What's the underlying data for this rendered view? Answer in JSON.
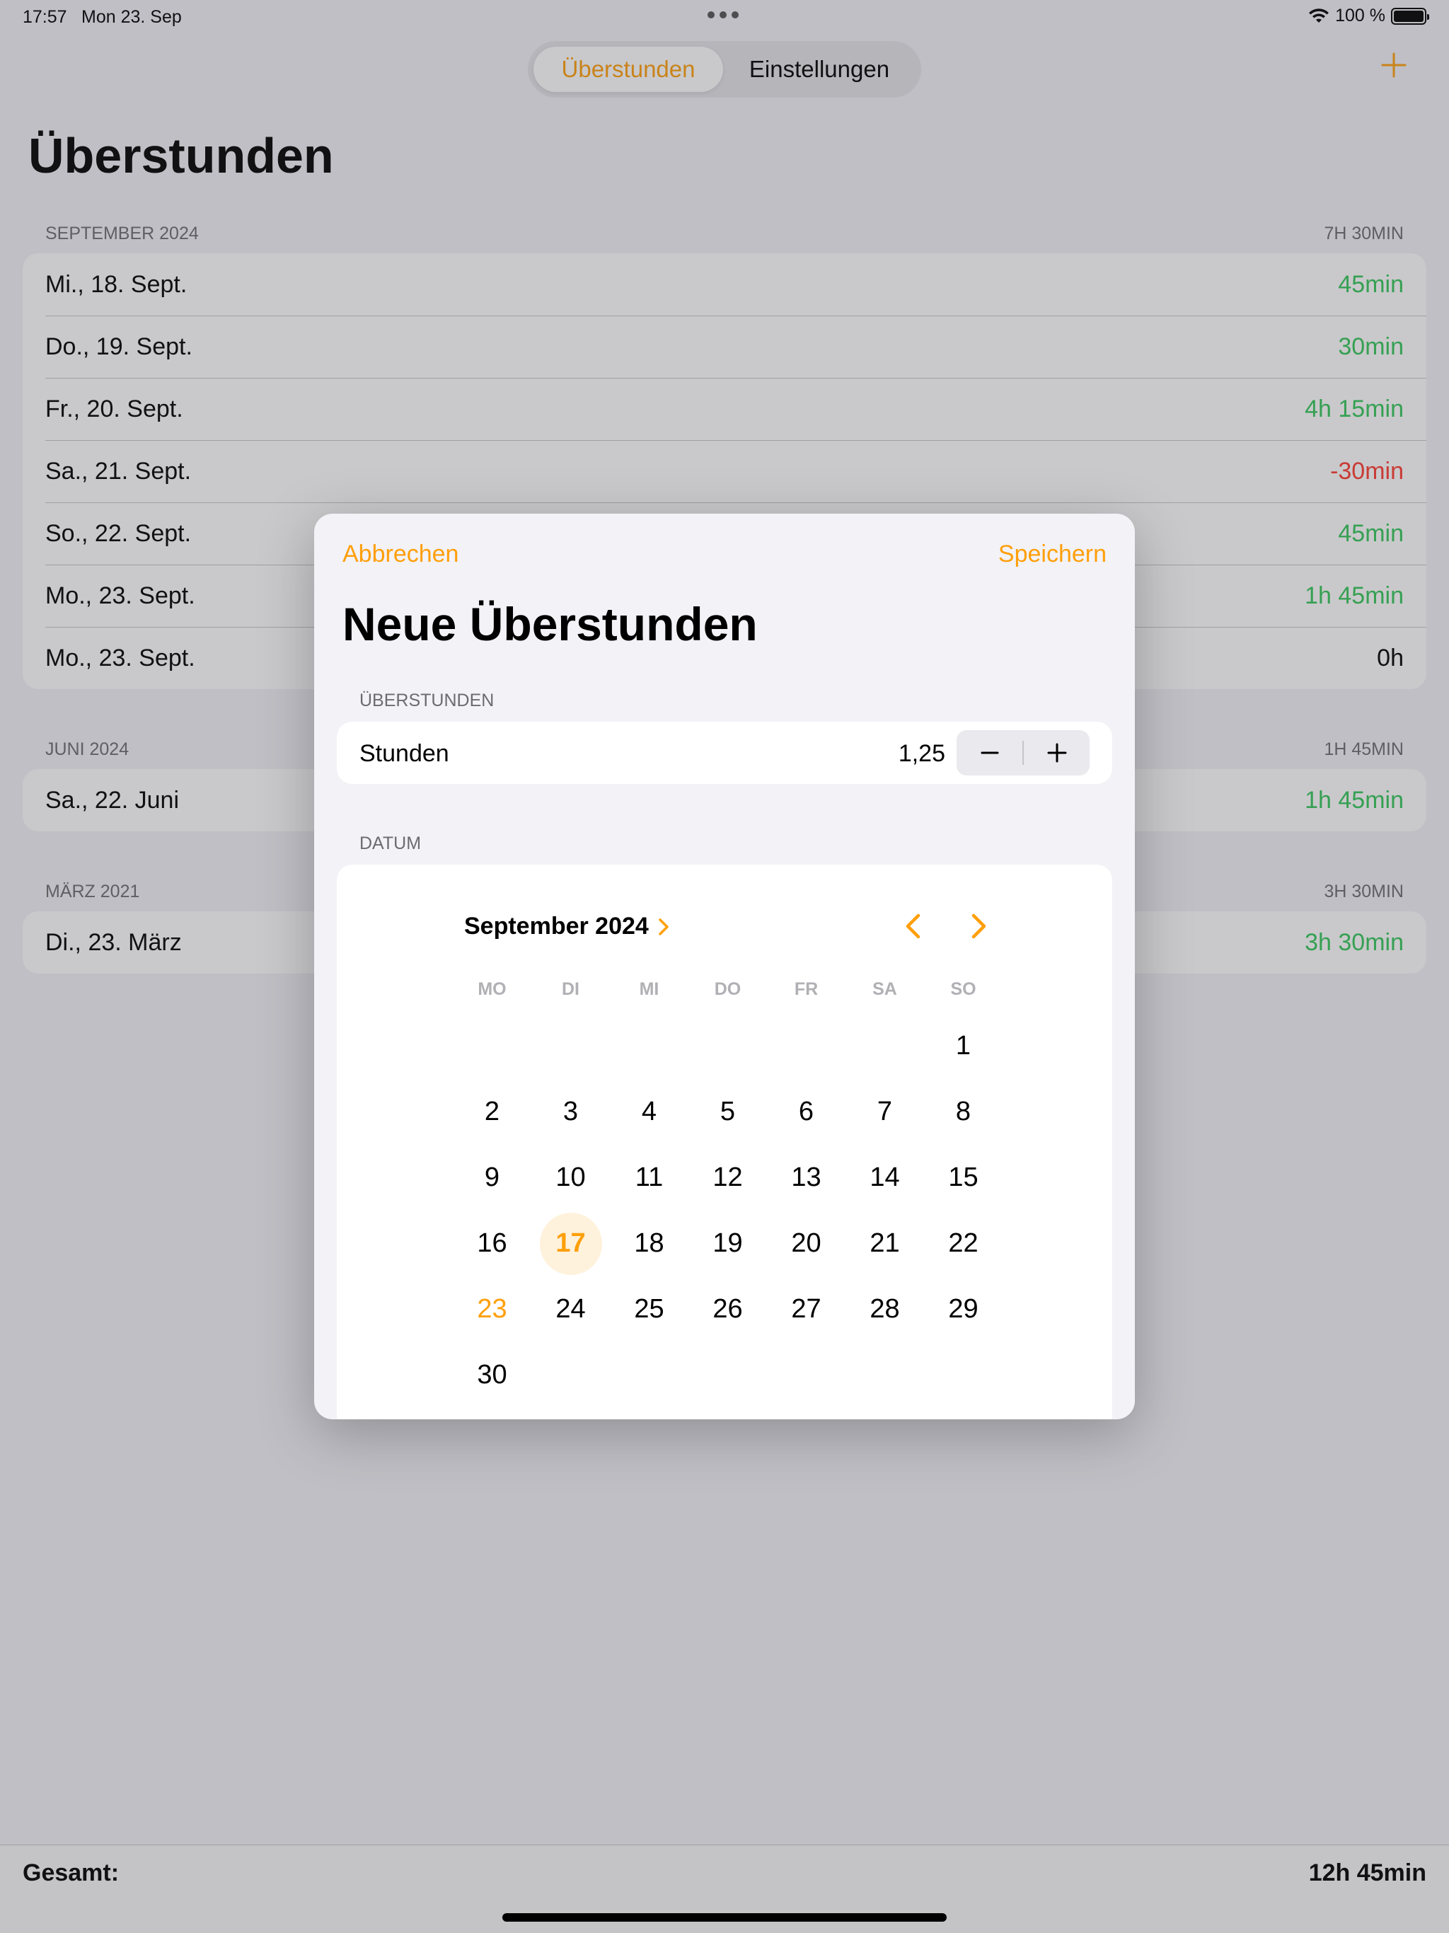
{
  "status_bar": {
    "time": "17:57",
    "date": "Mon 23. Sep",
    "battery": "100 %"
  },
  "segmented": {
    "active": "Überstunden",
    "inactive": "Einstellungen"
  },
  "title": "Überstunden",
  "sections": [
    {
      "header": "SEPTEMBER 2024",
      "total": "7H 30MIN",
      "rows": [
        {
          "date": "Mi., 18. Sept.",
          "value": "45min"
        },
        {
          "date": "Do., 19. Sept.",
          "value": "30min"
        },
        {
          "date": "Fr., 20. Sept.",
          "value": "4h 15min"
        },
        {
          "date": "Sa., 21. Sept.",
          "value": "-30min"
        },
        {
          "date": "So., 22. Sept.",
          "value": "45min"
        },
        {
          "date": "Mo., 23. Sept.",
          "value": "1h 45min"
        },
        {
          "date": "Mo., 23. Sept.",
          "value": "0h"
        }
      ]
    },
    {
      "header": "JUNI 2024",
      "total": "1H 45MIN",
      "rows": [
        {
          "date": "Sa., 22. Juni",
          "value": "1h 45min"
        }
      ]
    },
    {
      "header": "MÄRZ 2021",
      "total": "3H 30MIN",
      "rows": [
        {
          "date": "Di., 23. März",
          "value": "3h 30min"
        }
      ]
    }
  ],
  "footer": {
    "label": "Gesamt:",
    "total": "12h 45min"
  },
  "modal": {
    "cancel": "Abbrechen",
    "save": "Speichern",
    "title": "Neue Überstunden",
    "hours_section": "ÜBERSTUNDEN",
    "hours_label": "Stunden",
    "hours_value": "1,25",
    "date_section": "DATUM",
    "calendar": {
      "month": "September 2024",
      "weekdays": [
        "MO",
        "DI",
        "MI",
        "DO",
        "FR",
        "SA",
        "SO"
      ],
      "days": [
        "",
        "",
        "",
        "",
        "",
        "",
        "1",
        "2",
        "3",
        "4",
        "5",
        "6",
        "7",
        "8",
        "9",
        "10",
        "11",
        "12",
        "13",
        "14",
        "15",
        "16",
        "17",
        "18",
        "19",
        "20",
        "21",
        "22",
        "23",
        "24",
        "25",
        "26",
        "27",
        "28",
        "29",
        "30"
      ],
      "selected": "17",
      "today": "23"
    }
  },
  "colors": {
    "accent": "#ff9f0a",
    "positive": "#34c759",
    "negative": "#ff3b30"
  }
}
